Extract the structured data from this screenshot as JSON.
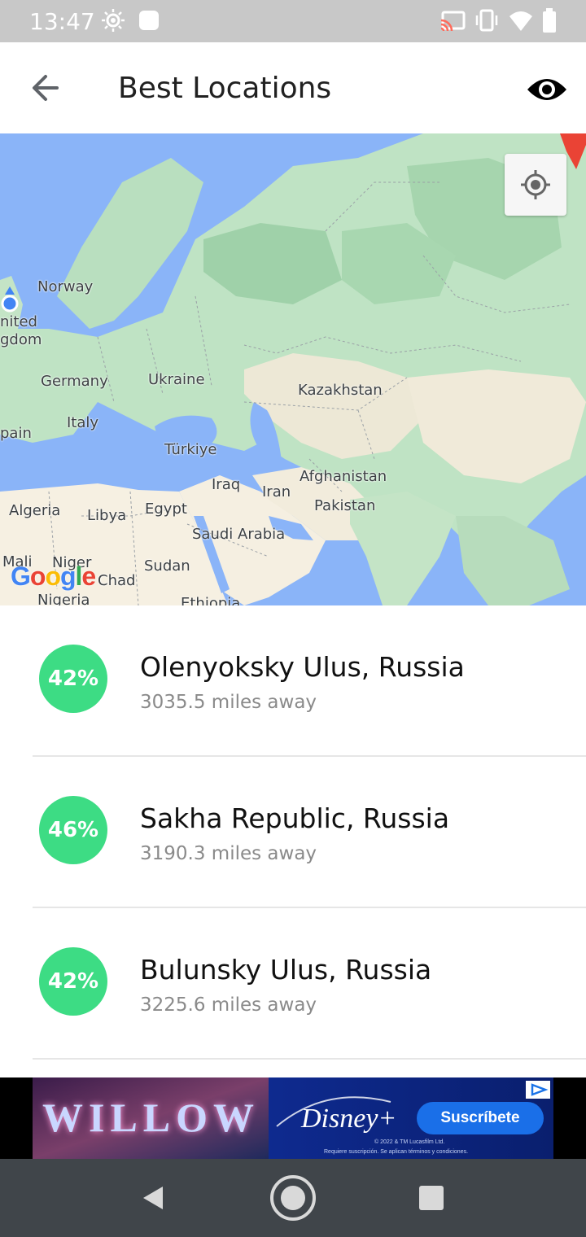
{
  "status_bar": {
    "time": "13:47",
    "icons": [
      "brightness-icon",
      "notification-square-icon",
      "cast-icon",
      "vibrate-icon",
      "wifi-icon",
      "battery-icon"
    ]
  },
  "app_bar": {
    "title": "Best Locations",
    "back_icon": "arrow-back-icon",
    "action_icon": "eye-icon"
  },
  "map": {
    "labels": {
      "norway": "Norway",
      "uk_part1": "nited",
      "uk_part2": "gdom",
      "germany": "Germany",
      "ukraine": "Ukraine",
      "kazakhstan": "Kazakhstan",
      "italy": "Italy",
      "spain": "pain",
      "turkiye": "Türkiye",
      "iraq": "Iraq",
      "iran": "Iran",
      "afghanistan": "Afghanistan",
      "pakistan": "Pakistan",
      "algeria": "Algeria",
      "libya": "Libya",
      "egypt": "Egypt",
      "saudi_arabia": "Saudi Arabia",
      "mali": "Mali",
      "niger": "Niger",
      "chad": "Chad",
      "sudan": "Sudan",
      "nigeria": "Nigeria",
      "ethiopia": "Ethiopia"
    },
    "logo": "Google",
    "my_location_icon": "my-location-icon",
    "colors": {
      "water": "#8ab4f8",
      "land_green": "#b7dfbe",
      "land_sand": "#f5efe1"
    }
  },
  "locations": [
    {
      "percent": "42%",
      "name": "Olenyoksky Ulus, Russia",
      "distance": "3035.5 miles away"
    },
    {
      "percent": "46%",
      "name": "Sakha Republic, Russia",
      "distance": "3190.3 miles away"
    },
    {
      "percent": "42%",
      "name": "Bulunsky Ulus, Russia",
      "distance": "3225.6 miles away"
    }
  ],
  "ad": {
    "movie_title": "WILLOW",
    "brand": "Disney+",
    "cta": "Suscríbete",
    "fine_print_1": "© 2022 & TM Lucasfilm Ltd.",
    "fine_print_2": "Requiere suscripción. Se aplican términos y condiciones."
  },
  "nav_bar": {
    "icons": [
      "nav-back-icon",
      "nav-home-icon",
      "nav-recents-icon"
    ]
  },
  "accent_color": "#3ddc84"
}
